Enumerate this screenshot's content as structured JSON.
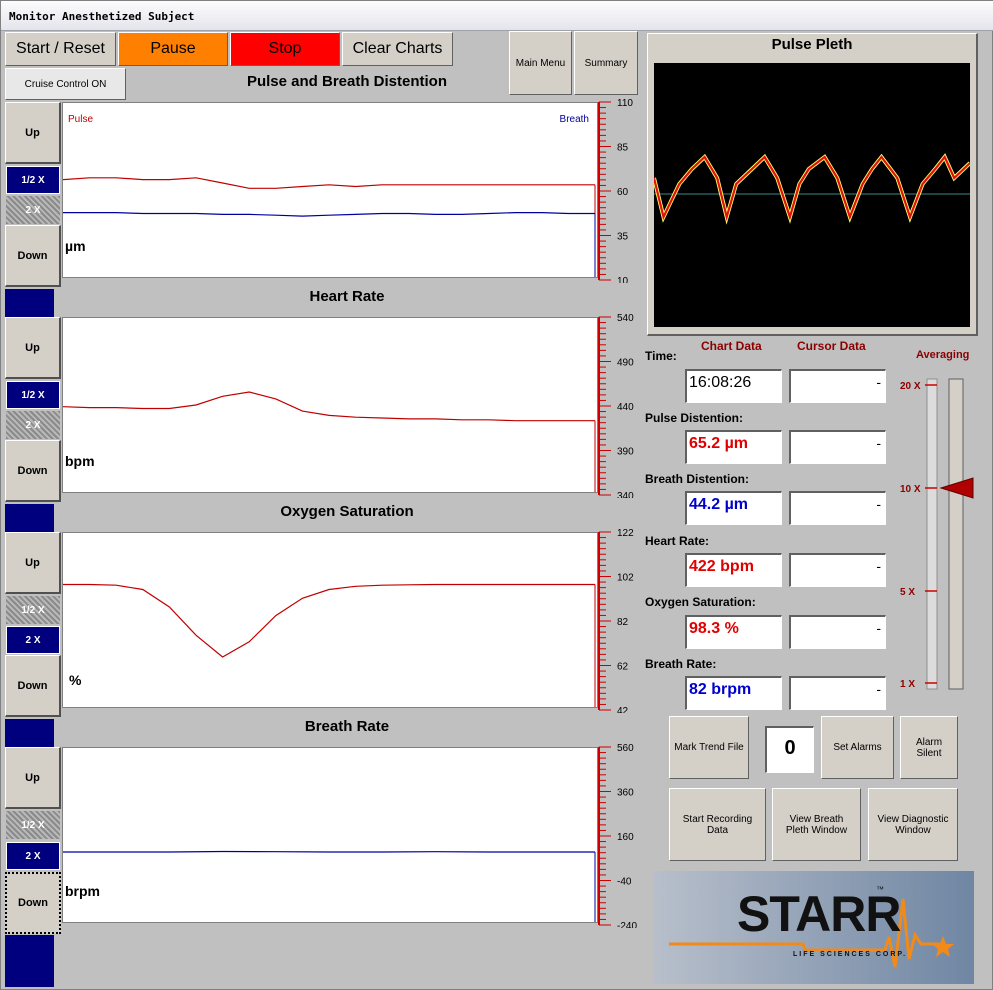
{
  "window": {
    "title": "Monitor Anesthetized Subject"
  },
  "toolbar": {
    "start_reset": "Start / Reset",
    "pause": "Pause",
    "stop": "Stop",
    "clear_charts": "Clear Charts",
    "main_menu": "Main Menu",
    "summary": "Summary",
    "cruise_control": "Cruise Control ON"
  },
  "colors": {
    "pause": "#ff8000",
    "stop": "#ff0000",
    "pulse": "#c00000",
    "breath": "#0000a0",
    "scale_red": "#cc0000"
  },
  "charts": [
    {
      "title": "Pulse and Breath Distention",
      "unit": "µm",
      "legend_left": "Pulse",
      "legend_right": "Breath",
      "up": "Up",
      "down": "Down",
      "half": "1/2 X",
      "double": "2 X",
      "ticks": [
        "110",
        "85",
        "60",
        "35",
        "10"
      ]
    },
    {
      "title": "Heart Rate",
      "unit": "bpm",
      "up": "Up",
      "down": "Down",
      "half": "1/2 X",
      "double": "2 X",
      "ticks": [
        "540",
        "490",
        "440",
        "390",
        "340"
      ]
    },
    {
      "title": "Oxygen  Saturation",
      "unit": "%",
      "up": "Up",
      "down": "Down",
      "half": "1/2 X",
      "double": "2 X",
      "ticks": [
        "122",
        "102",
        "82",
        "62",
        "42"
      ]
    },
    {
      "title": "Breath Rate",
      "unit": "brpm",
      "up": "Up",
      "down": "Down",
      "half": "1/2 X",
      "double": "2 X",
      "ticks": [
        "560",
        "360",
        "160",
        "-40",
        "-240"
      ]
    }
  ],
  "pleth": {
    "title": "Pulse Pleth"
  },
  "readouts": {
    "chart_data_header": "Chart Data",
    "cursor_data_header": "Cursor Data",
    "averaging_header": "Averaging",
    "time_label": "Time:",
    "time_value": "16:08:26",
    "pulse_label": "Pulse Distention:",
    "pulse_value": "65.2 µm",
    "breath_label": "Breath Distention:",
    "breath_value": "44.2 µm",
    "hr_label": "Heart Rate:",
    "hr_value": "422 bpm",
    "o2_label": "Oxygen Saturation:",
    "o2_value": "98.3 %",
    "br_label": "Breath Rate:",
    "br_value": "82 brpm",
    "cursor_placeholder": "-"
  },
  "averaging": {
    "ticks": [
      "20 X",
      "10 X",
      "5 X",
      "1 X"
    ],
    "level": "10 X"
  },
  "controls": {
    "mark_trend": "Mark Trend File",
    "counter": "0",
    "set_alarms": "Set Alarms",
    "alarm_silent": "Alarm Silent",
    "start_recording": "Start Recording Data",
    "view_breath": "View Breath Pleth Window",
    "view_diag": "View Diagnostic Window"
  },
  "logo": {
    "brand": "STARR",
    "tm": "™",
    "sub": "LIFE SCIENCES CORP."
  },
  "chart_data": [
    {
      "type": "line",
      "title": "Pulse and Breath Distention",
      "ylabel": "µm",
      "ylim": [
        10,
        110
      ],
      "x": [
        0,
        5,
        10,
        15,
        20,
        25,
        30,
        35,
        40,
        45,
        50,
        55,
        60,
        65,
        70,
        75,
        80,
        85,
        90,
        95,
        100
      ],
      "series": [
        {
          "name": "Pulse",
          "values": [
            66,
            67,
            67,
            66,
            66,
            67,
            64,
            61,
            61,
            62,
            63,
            62,
            63,
            63,
            63,
            63,
            63,
            63,
            63,
            63,
            63
          ]
        },
        {
          "name": "Breath",
          "values": [
            47,
            47,
            47,
            46.5,
            46.5,
            46.5,
            46,
            46,
            45.5,
            45,
            45.5,
            46,
            46.5,
            46.5,
            46,
            46,
            46.5,
            47,
            47,
            46.5,
            46.5
          ]
        }
      ]
    },
    {
      "type": "line",
      "title": "Heart Rate",
      "ylabel": "bpm",
      "ylim": [
        340,
        540
      ],
      "x": [
        0,
        5,
        10,
        15,
        20,
        25,
        30,
        35,
        40,
        45,
        50,
        55,
        60,
        65,
        70,
        75,
        80,
        85,
        90,
        95,
        100
      ],
      "series": [
        {
          "name": "",
          "values": [
            438,
            437,
            437,
            436,
            436,
            440,
            450,
            455,
            447,
            433,
            428,
            426,
            425,
            424,
            424,
            423,
            423,
            422,
            422,
            422,
            422
          ]
        }
      ]
    },
    {
      "type": "line",
      "title": "Oxygen  Saturation",
      "ylabel": "%",
      "ylim": [
        42,
        122
      ],
      "x": [
        0,
        5,
        10,
        15,
        20,
        25,
        30,
        35,
        40,
        45,
        50,
        55,
        60,
        65,
        70,
        75,
        80,
        85,
        90,
        95,
        100
      ],
      "series": [
        {
          "name": "",
          "values": [
            98.3,
            98.3,
            98,
            96,
            88,
            75,
            65,
            72,
            84,
            92,
            96,
            97.5,
            98,
            98.2,
            98.3,
            98.3,
            98.3,
            98.3,
            98.3,
            98.3,
            98.3
          ]
        }
      ]
    },
    {
      "type": "line",
      "title": "Breath Rate",
      "ylabel": "brpm",
      "ylim": [
        -240,
        560
      ],
      "x": [
        0,
        10,
        20,
        30,
        40,
        50,
        60,
        70,
        80,
        90,
        100
      ],
      "series": [
        {
          "name": "",
          "values": [
            82,
            82,
            82,
            84,
            83,
            82,
            82,
            83,
            82,
            82,
            82
          ]
        }
      ]
    },
    {
      "type": "line",
      "title": "Pulse Pleth",
      "x": [
        0,
        3,
        8,
        12,
        16,
        20,
        23,
        26,
        31,
        35,
        39,
        43,
        46,
        49,
        54,
        58,
        62,
        66,
        69,
        72,
        77,
        81,
        85,
        89,
        92,
        95,
        100
      ],
      "series": [
        {
          "name": "",
          "values": [
            0.2,
            -0.45,
            0.1,
            0.35,
            0.55,
            0.2,
            -0.45,
            0.1,
            0.35,
            0.55,
            0.2,
            -0.45,
            0.1,
            0.35,
            0.55,
            0.2,
            -0.45,
            0.1,
            0.35,
            0.55,
            0.2,
            -0.45,
            0.1,
            0.35,
            0.55,
            0.2,
            0.45
          ]
        }
      ]
    }
  ]
}
